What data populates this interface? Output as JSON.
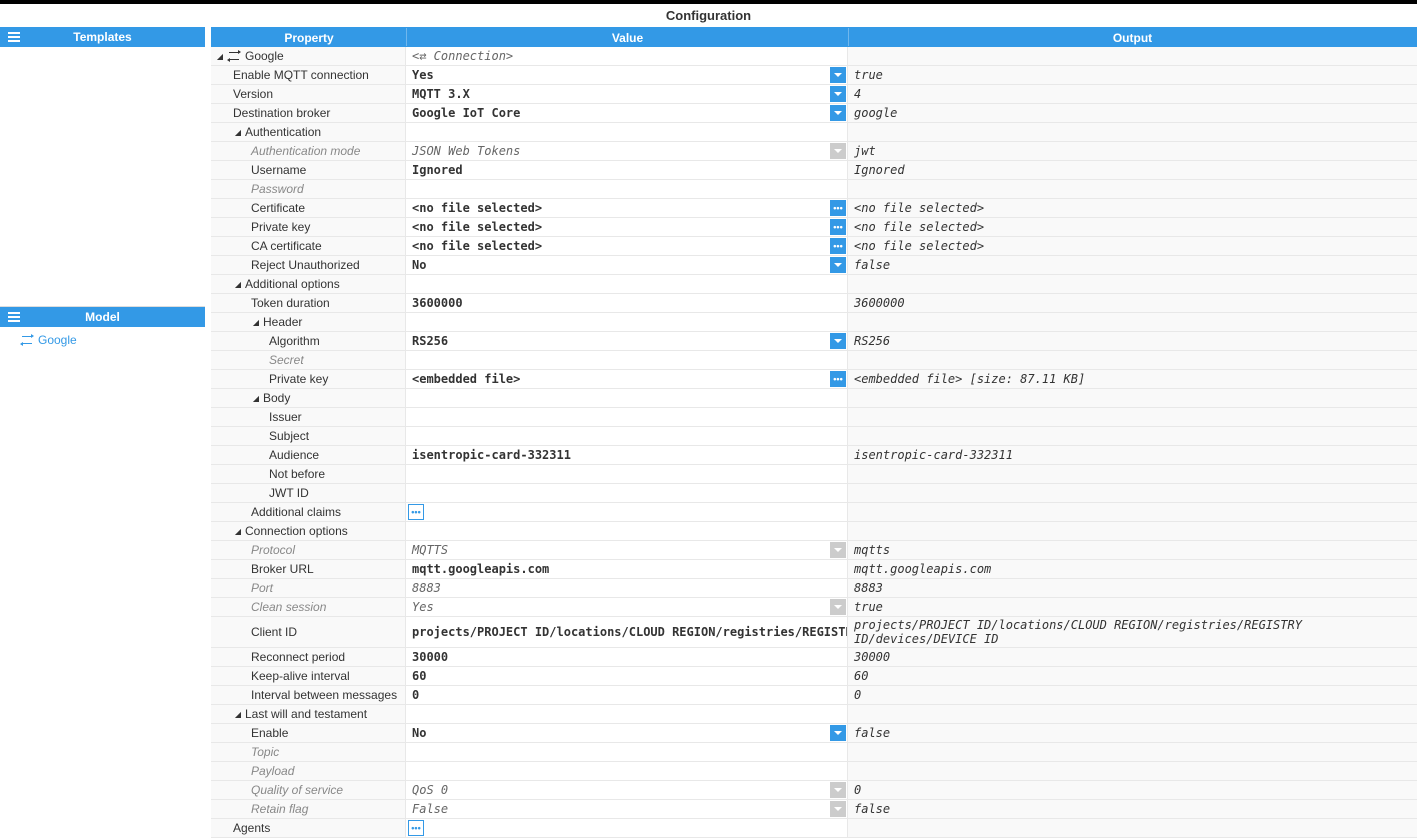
{
  "title": "Configuration",
  "sidebar": {
    "templates_header": "Templates",
    "model_header": "Model",
    "model_item": "Google"
  },
  "headers": {
    "property": "Property",
    "value": "Value",
    "output": "Output"
  },
  "rows": [
    {
      "indent": 0,
      "toggle": "▲",
      "icon": "swap",
      "prop": "Google",
      "value": "<⇄ Connection>",
      "value_style": "italic",
      "output": "",
      "btn": ""
    },
    {
      "indent": 1,
      "prop": "Enable MQTT connection",
      "value": "Yes",
      "output": "true",
      "btn": "dropdown"
    },
    {
      "indent": 1,
      "prop": "Version",
      "value": "MQTT 3.X",
      "output": "4",
      "btn": "dropdown"
    },
    {
      "indent": 1,
      "prop": "Destination broker",
      "value": "Google IoT Core",
      "output": "google",
      "btn": "dropdown"
    },
    {
      "indent": 1,
      "toggle": "▲",
      "prop": "Authentication",
      "value": "",
      "output": "",
      "btn": ""
    },
    {
      "indent": 2,
      "prop": "Authentication mode",
      "prop_style": "italic",
      "value": "JSON Web Tokens",
      "value_style": "italic",
      "output": "jwt",
      "btn": "dropdown-disabled"
    },
    {
      "indent": 2,
      "prop": "Username",
      "value": "Ignored",
      "output": "Ignored",
      "btn": ""
    },
    {
      "indent": 2,
      "prop": "Password",
      "prop_style": "italic",
      "value": "",
      "output": "",
      "btn": ""
    },
    {
      "indent": 2,
      "prop": "Certificate",
      "value": "<no file selected>",
      "output": "<no file selected>",
      "btn": "ellipsis"
    },
    {
      "indent": 2,
      "prop": "Private key",
      "value": "<no file selected>",
      "output": "<no file selected>",
      "btn": "ellipsis"
    },
    {
      "indent": 2,
      "prop": "CA certificate",
      "value": "<no file selected>",
      "output": "<no file selected>",
      "btn": "ellipsis"
    },
    {
      "indent": 2,
      "prop": "Reject Unauthorized",
      "value": "No",
      "output": "false",
      "btn": "dropdown"
    },
    {
      "indent": 1,
      "toggle": "▲",
      "prop": "Additional options",
      "value": "",
      "output": "",
      "btn": ""
    },
    {
      "indent": 2,
      "prop": "Token duration",
      "value": "3600000",
      "output": "3600000",
      "btn": ""
    },
    {
      "indent": 2,
      "toggle": "▲",
      "prop": "Header",
      "value": "",
      "output": "",
      "btn": ""
    },
    {
      "indent": 3,
      "prop": "Algorithm",
      "value": "RS256",
      "output": "RS256",
      "btn": "dropdown"
    },
    {
      "indent": 3,
      "prop": "Secret",
      "prop_style": "italic",
      "value": "",
      "output": "",
      "btn": ""
    },
    {
      "indent": 3,
      "prop": "Private key",
      "value": "<embedded file>",
      "output": "<embedded file> [size: 87.11 KB]",
      "btn": "ellipsis"
    },
    {
      "indent": 2,
      "toggle": "▲",
      "prop": "Body",
      "value": "",
      "output": "",
      "btn": ""
    },
    {
      "indent": 3,
      "prop": "Issuer",
      "value": "",
      "output": "",
      "btn": ""
    },
    {
      "indent": 3,
      "prop": "Subject",
      "value": "",
      "output": "",
      "btn": ""
    },
    {
      "indent": 3,
      "prop": "Audience",
      "value": "isentropic-card-332311",
      "output": "isentropic-card-332311",
      "btn": ""
    },
    {
      "indent": 3,
      "prop": "Not before",
      "value": "",
      "output": "",
      "btn": ""
    },
    {
      "indent": 3,
      "prop": "JWT ID",
      "value": "",
      "output": "",
      "btn": ""
    },
    {
      "indent": 2,
      "prop": "Additional claims",
      "value": "",
      "output": "",
      "btn": "ellipsis-inline"
    },
    {
      "indent": 1,
      "toggle": "▲",
      "prop": "Connection options",
      "value": "",
      "output": "",
      "btn": ""
    },
    {
      "indent": 2,
      "prop": "Protocol",
      "prop_style": "italic",
      "value": "MQTTS",
      "value_style": "italic",
      "output": "mqtts",
      "btn": "dropdown-disabled"
    },
    {
      "indent": 2,
      "prop": "Broker URL",
      "value": "mqtt.googleapis.com",
      "output": "mqtt.googleapis.com",
      "btn": ""
    },
    {
      "indent": 2,
      "prop": "Port",
      "prop_style": "italic",
      "value": "8883",
      "value_style": "italic",
      "output": "8883",
      "btn": ""
    },
    {
      "indent": 2,
      "prop": "Clean session",
      "prop_style": "italic",
      "value": "Yes",
      "value_style": "italic",
      "output": "true",
      "btn": "dropdown-disabled"
    },
    {
      "indent": 2,
      "prop": "Client ID",
      "value": "projects/PROJECT ID/locations/CLOUD REGION/registries/REGISTRY ID/",
      "output": "projects/PROJECT ID/locations/CLOUD REGION/registries/REGISTRY ID/devices/DEVICE ID",
      "btn": ""
    },
    {
      "indent": 2,
      "prop": "Reconnect period",
      "value": "30000",
      "output": "30000",
      "btn": ""
    },
    {
      "indent": 2,
      "prop": "Keep-alive interval",
      "value": "60",
      "output": "60",
      "btn": ""
    },
    {
      "indent": 2,
      "prop": "Interval between messages",
      "value": "0",
      "output": "0",
      "btn": ""
    },
    {
      "indent": 1,
      "toggle": "▲",
      "prop": "Last will and testament",
      "value": "",
      "output": "",
      "btn": ""
    },
    {
      "indent": 2,
      "prop": "Enable",
      "value": "No",
      "output": "false",
      "btn": "dropdown"
    },
    {
      "indent": 2,
      "prop": "Topic",
      "prop_style": "italic",
      "value": "",
      "output": "",
      "btn": ""
    },
    {
      "indent": 2,
      "prop": "Payload",
      "prop_style": "italic",
      "value": "",
      "output": "",
      "btn": ""
    },
    {
      "indent": 2,
      "prop": "Quality of service",
      "prop_style": "italic",
      "value": "QoS 0",
      "value_style": "italic",
      "output": "0",
      "btn": "dropdown-disabled"
    },
    {
      "indent": 2,
      "prop": "Retain flag",
      "prop_style": "italic",
      "value": "False",
      "value_style": "italic",
      "output": "false",
      "btn": "dropdown-disabled"
    },
    {
      "indent": 1,
      "prop": "Agents",
      "value": "",
      "output": "",
      "btn": "ellipsis-inline"
    }
  ]
}
